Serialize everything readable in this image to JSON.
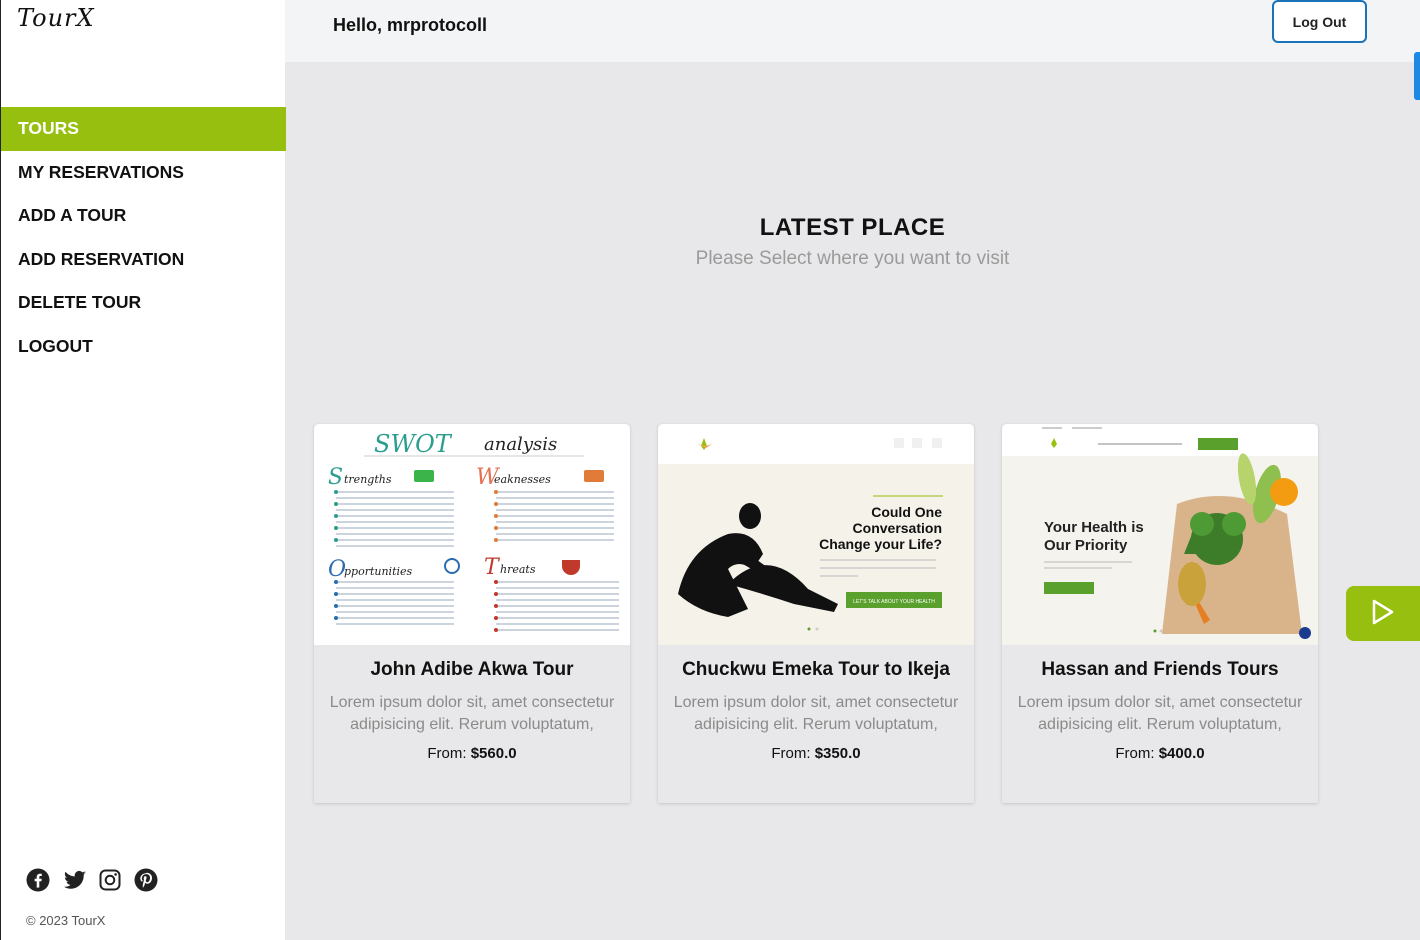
{
  "app": {
    "logo": "TourX"
  },
  "sidebar": {
    "items": [
      {
        "label": "TOURS",
        "active": true
      },
      {
        "label": "MY RESERVATIONS"
      },
      {
        "label": "ADD A TOUR"
      },
      {
        "label": "ADD RESERVATION"
      },
      {
        "label": "DELETE TOUR"
      },
      {
        "label": "LOGOUT"
      }
    ],
    "socials": [
      "facebook-icon",
      "twitter-icon",
      "instagram-icon",
      "pinterest-icon"
    ],
    "copyright": "© 2023 TourX"
  },
  "header": {
    "greeting": "Hello, mrprotocoll",
    "logout_label": "Log Out"
  },
  "main": {
    "title": "LATEST PLACE",
    "subtitle": "Please Select where you want to visit",
    "price_prefix": "From: ",
    "cards": [
      {
        "title": "John Adibe Akwa Tour",
        "description": "Lorem ipsum dolor sit, amet consectetur adipisicing elit. Rerum voluptatum,",
        "price": "$560.0",
        "image": {
          "heading_main": "SWOT",
          "heading_sub": "analysis",
          "quadrants": [
            "trengths",
            "eaknesses",
            "pportunities",
            "hreats"
          ],
          "quadrant_initials": [
            "S",
            "W",
            "O",
            "T"
          ]
        }
      },
      {
        "title": "Chuckwu Emeka Tour to Ikeja",
        "description": "Lorem ipsum dolor sit, amet consectetur adipisicing elit. Rerum voluptatum,",
        "price": "$350.0",
        "image": {
          "headline_1": "Could One",
          "headline_2": "Conversation",
          "headline_3": "Change your Life?",
          "cta": "LET'S TALK ABOUT YOUR HEALTH"
        }
      },
      {
        "title": "Hassan and Friends Tours",
        "description": "Lorem ipsum dolor sit, amet consectetur adipisicing elit. Rerum voluptatum,",
        "price": "$400.0",
        "image": {
          "headline_1": "Your Health is",
          "headline_2": "Our Priority"
        }
      }
    ]
  },
  "colors": {
    "accent": "#97bf0f",
    "link_blue": "#1a73b8"
  }
}
